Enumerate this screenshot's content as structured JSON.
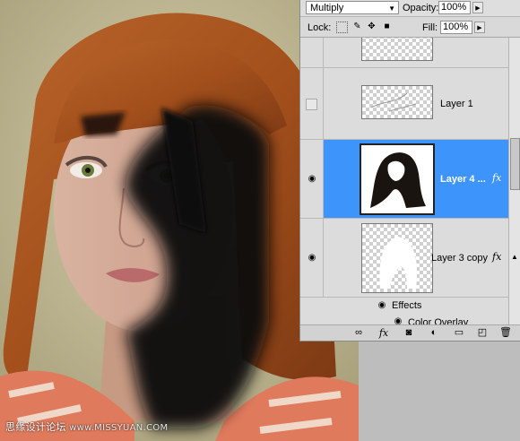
{
  "blend_mode": "Multiply",
  "opacity_label": "Opacity:",
  "opacity_value": "100%",
  "lock_label": "Lock:",
  "fill_label": "Fill:",
  "fill_value": "100%",
  "layers": [
    {
      "name": "Layer 1",
      "visible": false,
      "selected": false,
      "has_fx": false
    },
    {
      "name": "Layer 4 ...",
      "visible": true,
      "selected": true,
      "has_fx": true
    },
    {
      "name": "Layer 3 copy",
      "visible": true,
      "selected": false,
      "has_fx": true
    }
  ],
  "effects_label": "Effects",
  "color_overlay_label": "Color Overlay",
  "fx_symbol": "fx",
  "watermark": {
    "cn": "思缘设计论坛",
    "site": "www.MISSYUAN.COM"
  },
  "icons": {
    "eye": "eye-icon",
    "lock_transparent": "lock-transparent-icon",
    "lock_paint": "brush-icon",
    "lock_move": "move-icon",
    "lock_all": "lock-icon",
    "link": "link-icon",
    "add_style": "fx-icon",
    "mask": "mask-icon",
    "adjustment": "adjustment-icon",
    "group": "folder-icon",
    "new_layer": "new-layer-icon",
    "delete": "trash-icon"
  },
  "colors": {
    "selection": "#3d95fc",
    "panel_bg": "#d6d6d6",
    "hair": "#a6521d",
    "shadow": "#0c0908"
  }
}
